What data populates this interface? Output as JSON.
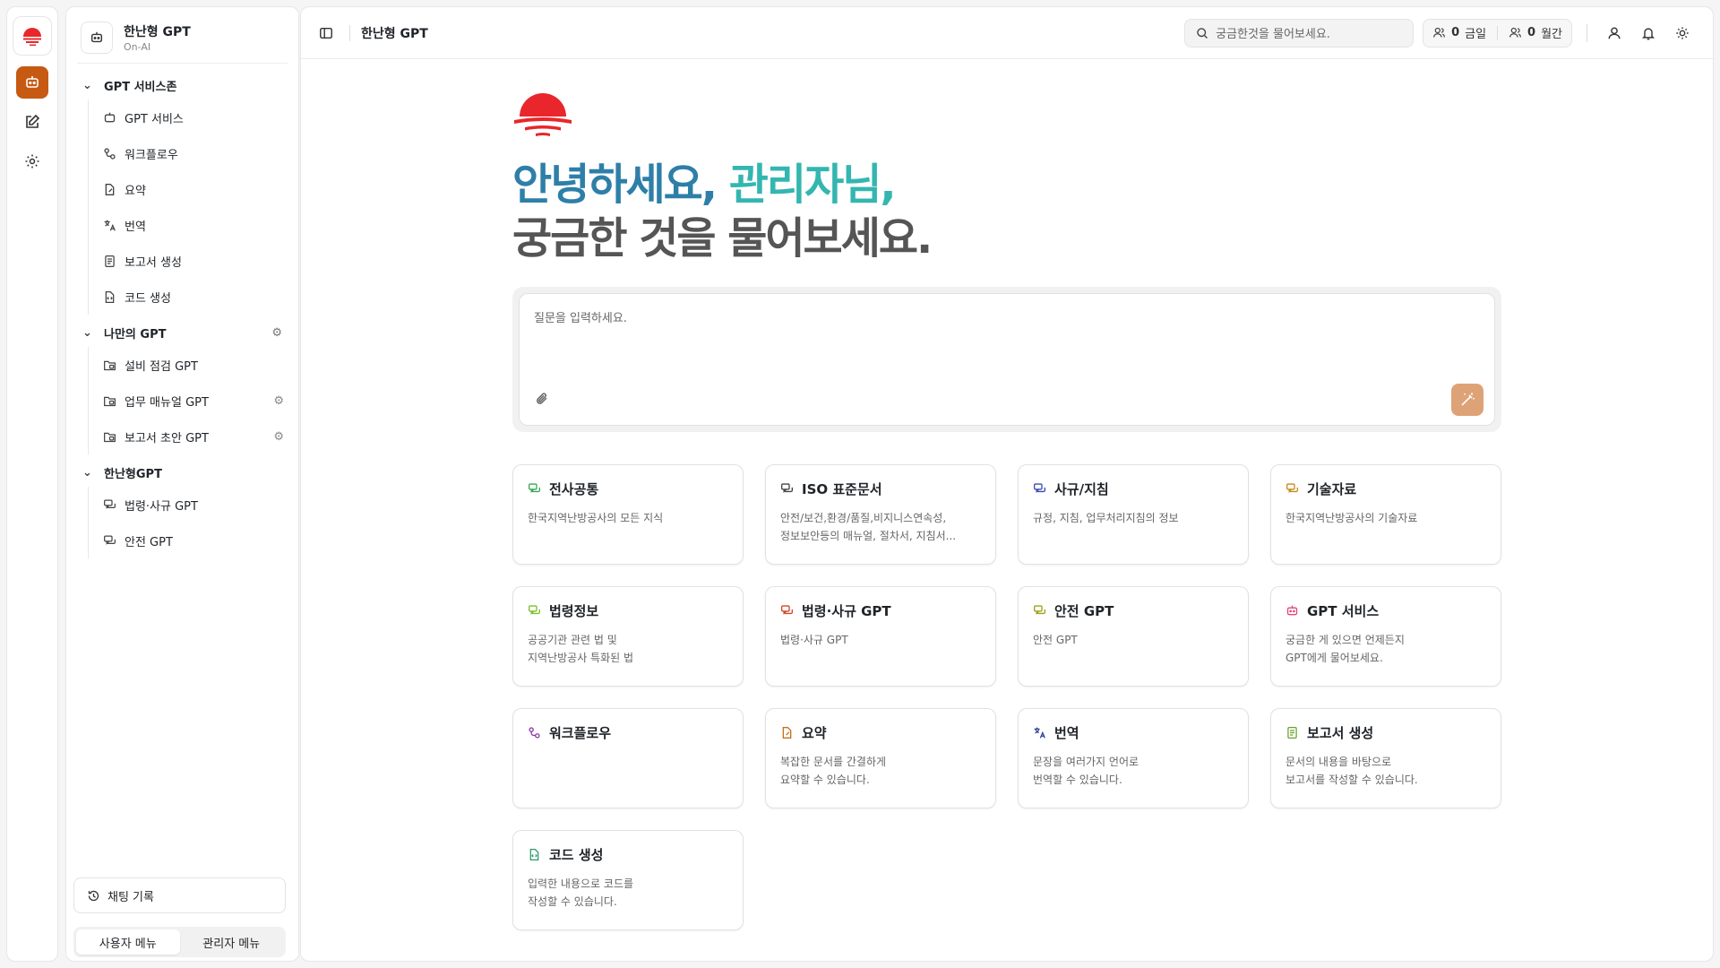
{
  "colors": {
    "accent": "#c65a13",
    "brand_red": "#e8262b",
    "greet_blue": "#2e7fa8",
    "greet_teal": "#34b6b0",
    "send_bg": "#dea277"
  },
  "sidebar": {
    "app_title": "한난형 GPT",
    "app_subtitle": "On-AI",
    "groups": [
      {
        "label": "GPT 서비스존",
        "items": [
          {
            "label": "GPT 서비스",
            "icon": "chatbot-icon"
          },
          {
            "label": "워크플로우",
            "icon": "workflow-icon"
          },
          {
            "label": "요약",
            "icon": "summary-icon"
          },
          {
            "label": "번역",
            "icon": "translate-icon"
          },
          {
            "label": "보고서 생성",
            "icon": "report-icon"
          },
          {
            "label": "코드 생성",
            "icon": "code-icon"
          }
        ]
      },
      {
        "label": "나만의 GPT",
        "items": [
          {
            "label": "설비 점검 GPT",
            "icon": "folder-chat-icon"
          },
          {
            "label": "업무 매뉴얼 GPT",
            "icon": "folder-chat-icon"
          },
          {
            "label": "보고서 초안 GPT",
            "icon": "folder-chat-icon"
          }
        ]
      },
      {
        "label": "한난형GPT",
        "items": [
          {
            "label": "법령·사규 GPT",
            "icon": "chat-bubbles-icon"
          },
          {
            "label": "안전 GPT",
            "icon": "chat-bubbles-icon"
          }
        ]
      }
    ],
    "chat_history": "채팅 기록",
    "user_menu": "사용자 메뉴",
    "admin_menu": "관리자 메뉴"
  },
  "topbar": {
    "title": "한난형 GPT",
    "search_placeholder": "궁금한것을 물어보세요.",
    "today_count": "0",
    "today_label": "금일",
    "month_count": "0",
    "month_label": "월간"
  },
  "hero": {
    "greet_1": "안녕하세요,",
    "greet_2": "관리자님,",
    "greet_3": "궁금한 것을 물어보세요."
  },
  "ask": {
    "placeholder": "질문을 입력하세요."
  },
  "cards": [
    {
      "title": "전사공통",
      "desc": "한국지역난방공사의 모든 지식",
      "icon": "chat-bubbles-icon",
      "color": "#3aa655"
    },
    {
      "title": "ISO 표준문서",
      "desc": "안전/보건,환경/품질,비지니스연속성,\n정보보안등의 매뉴얼, 절차서, 지침서...",
      "icon": "chat-bubbles-icon",
      "color": "#444444"
    },
    {
      "title": "사규/지침",
      "desc": "규정, 지침, 업무처리지침의 정보",
      "icon": "chat-bubbles-icon",
      "color": "#3b4bb0"
    },
    {
      "title": "기술자료",
      "desc": "한국지역난방공사의 기술자료",
      "icon": "chat-bubbles-icon",
      "color": "#c88a1a"
    },
    {
      "title": "법령정보",
      "desc": "공공기관 관련 법 및\n지역난방공사 특화된 법",
      "icon": "chat-bubbles-icon",
      "color": "#7cbf2a"
    },
    {
      "title": "법령·사규 GPT",
      "desc": "법령·사규 GPT",
      "icon": "chat-bubbles-icon",
      "color": "#d0462a"
    },
    {
      "title": "안전 GPT",
      "desc": "안전 GPT",
      "icon": "chat-bubbles-icon",
      "color": "#9aa21a"
    },
    {
      "title": "GPT 서비스",
      "desc": "궁금한 게 있으면 언제든지\nGPT에게 물어보세요.",
      "icon": "chatbot-icon",
      "color": "#e0457a"
    },
    {
      "title": "워크플로우",
      "desc": "",
      "icon": "workflow-icon",
      "color": "#8a3aa8"
    },
    {
      "title": "요약",
      "desc": "복잡한 문서를 간결하게\n요약할 수 있습니다.",
      "icon": "summary-icon",
      "color": "#c8701a"
    },
    {
      "title": "번역",
      "desc": "문장을 여러가지 언어로\n번역할 수 있습니다.",
      "icon": "translate-icon",
      "color": "#2a3a9a"
    },
    {
      "title": "보고서 생성",
      "desc": "문서의 내용을 바탕으로\n보고서를 작성할 수 있습니다.",
      "icon": "report-icon",
      "color": "#6aa02a"
    },
    {
      "title": "코드 생성",
      "desc": "입력한 내용으로 코드를\n작성할 수 있습니다.",
      "icon": "code-icon",
      "color": "#2a9a6a"
    }
  ]
}
